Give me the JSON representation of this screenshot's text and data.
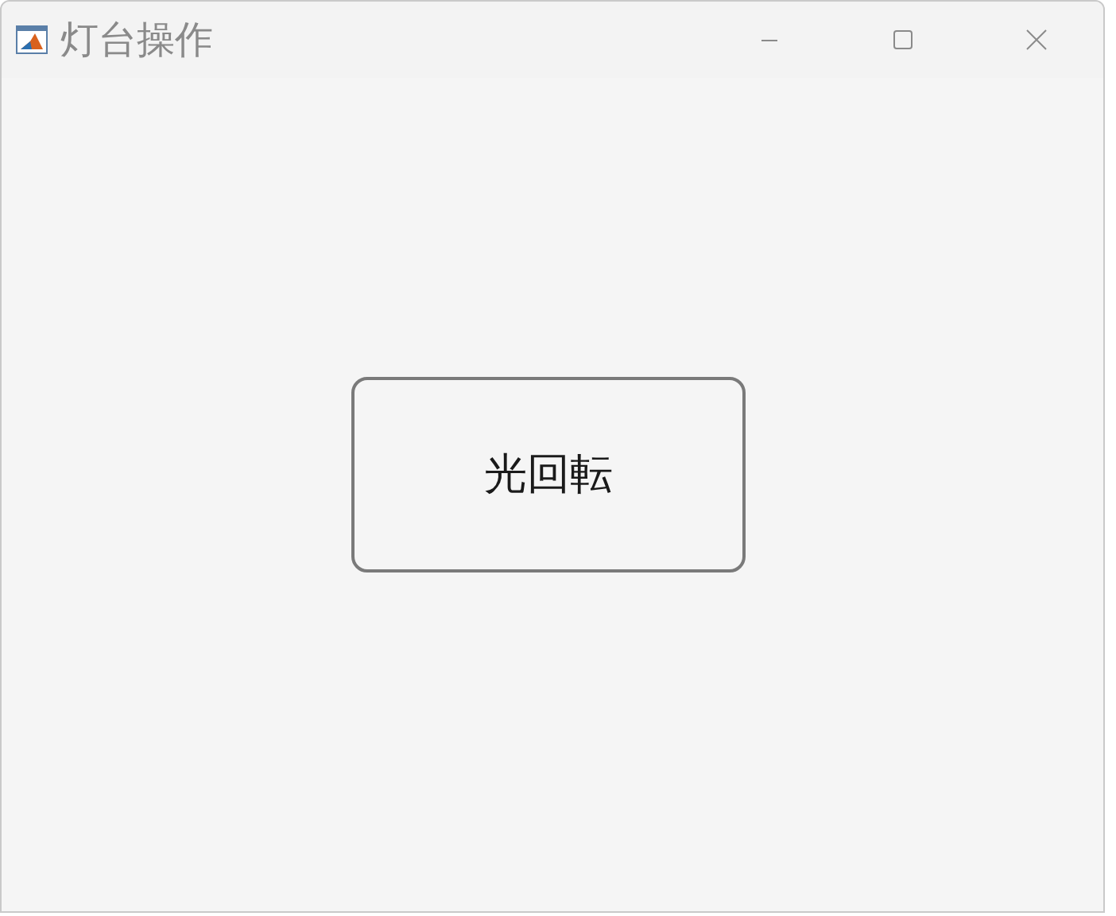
{
  "window": {
    "title": "灯台操作"
  },
  "button": {
    "label": "光回転"
  }
}
